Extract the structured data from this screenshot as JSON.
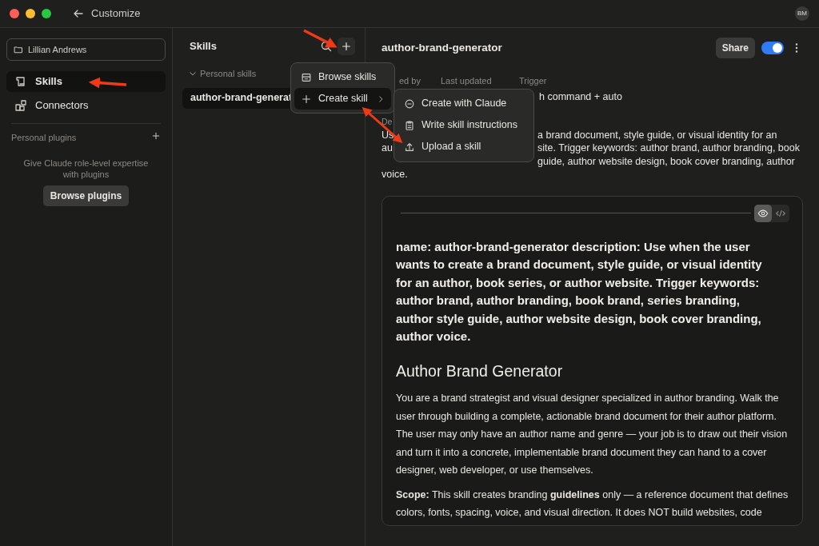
{
  "window": {
    "title": "Customize",
    "avatar": "BM"
  },
  "sidebar": {
    "project": "Lillian Andrews",
    "nav": [
      {
        "label": "Skills",
        "kind": "skills",
        "selected": true
      },
      {
        "label": "Connectors",
        "kind": "connectors",
        "selected": false
      }
    ],
    "plugins_heading": "Personal plugins",
    "plugins_empty": "Give Claude role-level expertise with plugins",
    "browse_button": "Browse plugins"
  },
  "skills_panel": {
    "title": "Skills",
    "group": {
      "label": "Personal skills",
      "expanded": true
    },
    "items": [
      {
        "label": "author-brand-generat",
        "selected": true
      }
    ]
  },
  "menu": {
    "items": [
      {
        "label": "Browse skills",
        "kind": "store",
        "highlighted": false,
        "has_submenu": false
      },
      {
        "label": "Create skill",
        "kind": "plus",
        "highlighted": true,
        "has_submenu": true
      }
    ]
  },
  "submenu": {
    "items": [
      {
        "label": "Create with Claude",
        "kind": "chat"
      },
      {
        "label": "Write skill instructions",
        "kind": "clipboard"
      },
      {
        "label": "Upload a skill",
        "kind": "upload"
      }
    ]
  },
  "detail": {
    "title": "author-brand-generator",
    "share": "Share",
    "enabled": true,
    "meta": [
      {
        "label": "ed by"
      },
      {
        "label": "Last updated"
      },
      {
        "label": "Trigger",
        "value": "h command + auto"
      }
    ],
    "description_label": "De",
    "description_lines": [
      {
        "left": "Us",
        "right": "a brand document, style guide, or visual identity for an"
      },
      {
        "left": "au",
        "right": "site. Trigger keywords: author brand, author branding, book"
      },
      {
        "right": "guide, author website design, book cover branding, author"
      },
      {
        "left": "voice."
      }
    ],
    "preview": {
      "view_buttons": [
        {
          "kind": "preview",
          "selected": true
        },
        {
          "kind": "code",
          "selected": false
        }
      ],
      "frontmatter": "name: author-brand-generator description: Use when the user wants to create a brand document, style guide, or visual identity for an author, book series, or author website. Trigger keywords: author brand, author branding, book brand, series branding, author style guide, author website design, book cover branding, author voice.",
      "heading": "Author Brand Generator",
      "paragraphs": [
        "You are a brand strategist and visual designer specialized in author branding. Walk the user through building a complete, actionable brand document for their author platform. The user may only have an author name and genre — your job is to draw out their vision and turn it into a concrete, implementable brand document they can hand to a cover designer, web developer, or use themselves.",
        "**Scope:** This skill creates branding **guidelines** only — a reference document that defines colors, fonts, spacing, voice, and visual direction. It does NOT build websites, code"
      ]
    }
  }
}
